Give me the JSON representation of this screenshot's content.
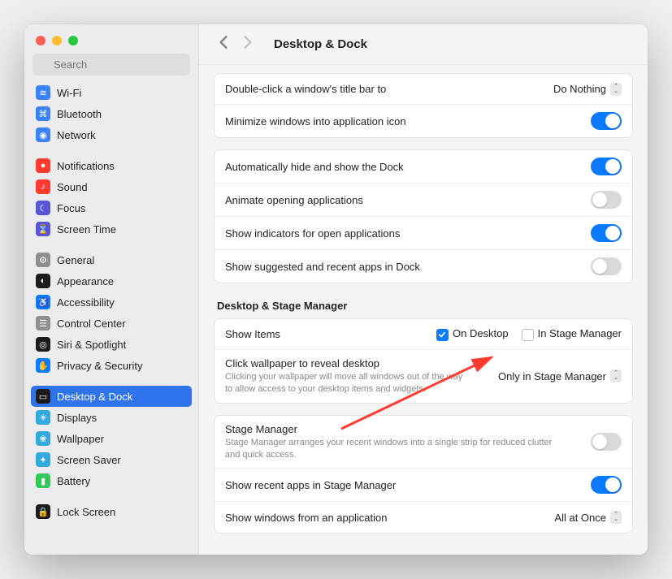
{
  "header": {
    "title": "Desktop & Dock"
  },
  "search": {
    "placeholder": "Search"
  },
  "sidebar": {
    "items": [
      {
        "label": "Wi-Fi",
        "icon_bg": "#3a82f7",
        "glyph": "≋"
      },
      {
        "label": "Bluetooth",
        "icon_bg": "#3a82f7",
        "glyph": "⌘"
      },
      {
        "label": "Network",
        "icon_bg": "#3a82f7",
        "glyph": "◉"
      },
      {
        "gap": true
      },
      {
        "label": "Notifications",
        "icon_bg": "#ff3b30",
        "glyph": "●"
      },
      {
        "label": "Sound",
        "icon_bg": "#ff3b30",
        "glyph": "♪"
      },
      {
        "label": "Focus",
        "icon_bg": "#5856d6",
        "glyph": "☾"
      },
      {
        "label": "Screen Time",
        "icon_bg": "#5856d6",
        "glyph": "⌛"
      },
      {
        "gap": true
      },
      {
        "label": "General",
        "icon_bg": "#8e8e93",
        "glyph": "⚙"
      },
      {
        "label": "Appearance",
        "icon_bg": "#1c1c1e",
        "glyph": "◐"
      },
      {
        "label": "Accessibility",
        "icon_bg": "#0a7aff",
        "glyph": "♿"
      },
      {
        "label": "Control Center",
        "icon_bg": "#8e8e93",
        "glyph": "☰"
      },
      {
        "label": "Siri & Spotlight",
        "icon_bg": "#1c1c1e",
        "glyph": "◎"
      },
      {
        "label": "Privacy & Security",
        "icon_bg": "#0a7aff",
        "glyph": "✋"
      },
      {
        "gap": true
      },
      {
        "label": "Desktop & Dock",
        "icon_bg": "#1c1c1e",
        "glyph": "▭",
        "selected": true
      },
      {
        "label": "Displays",
        "icon_bg": "#34aadc",
        "glyph": "☀"
      },
      {
        "label": "Wallpaper",
        "icon_bg": "#34aadc",
        "glyph": "❀"
      },
      {
        "label": "Screen Saver",
        "icon_bg": "#34aadc",
        "glyph": "✦"
      },
      {
        "label": "Battery",
        "icon_bg": "#34c759",
        "glyph": "▮"
      },
      {
        "gap": true
      },
      {
        "label": "Lock Screen",
        "icon_bg": "#1c1c1e",
        "glyph": "🔒"
      }
    ]
  },
  "groups": {
    "g1": [
      {
        "label": "Double-click a window's title bar to",
        "control": "popup",
        "value": "Do Nothing"
      },
      {
        "label": "Minimize windows into application icon",
        "control": "switch",
        "on": true
      }
    ],
    "g2": [
      {
        "label": "Automatically hide and show the Dock",
        "control": "switch",
        "on": true
      },
      {
        "label": "Animate opening applications",
        "control": "switch",
        "on": false
      },
      {
        "label": "Show indicators for open applications",
        "control": "switch",
        "on": true
      },
      {
        "label": "Show suggested and recent apps in Dock",
        "control": "switch",
        "on": false
      }
    ]
  },
  "section2_title": "Desktop & Stage Manager",
  "g3": {
    "show_items_label": "Show Items",
    "on_desktop": "On Desktop",
    "in_stage_manager": "In Stage Manager",
    "click_wallpaper_label": "Click wallpaper to reveal desktop",
    "click_wallpaper_desc": "Clicking your wallpaper will move all windows out of the way to allow access to your desktop items and widgets.",
    "click_wallpaper_value": "Only in Stage Manager"
  },
  "g4": {
    "sm_label": "Stage Manager",
    "sm_desc": "Stage Manager arranges your recent windows into a single strip for reduced clutter and quick access.",
    "recent_label": "Show recent apps in Stage Manager",
    "show_windows_label": "Show windows from an application",
    "show_windows_value": "All at Once"
  }
}
